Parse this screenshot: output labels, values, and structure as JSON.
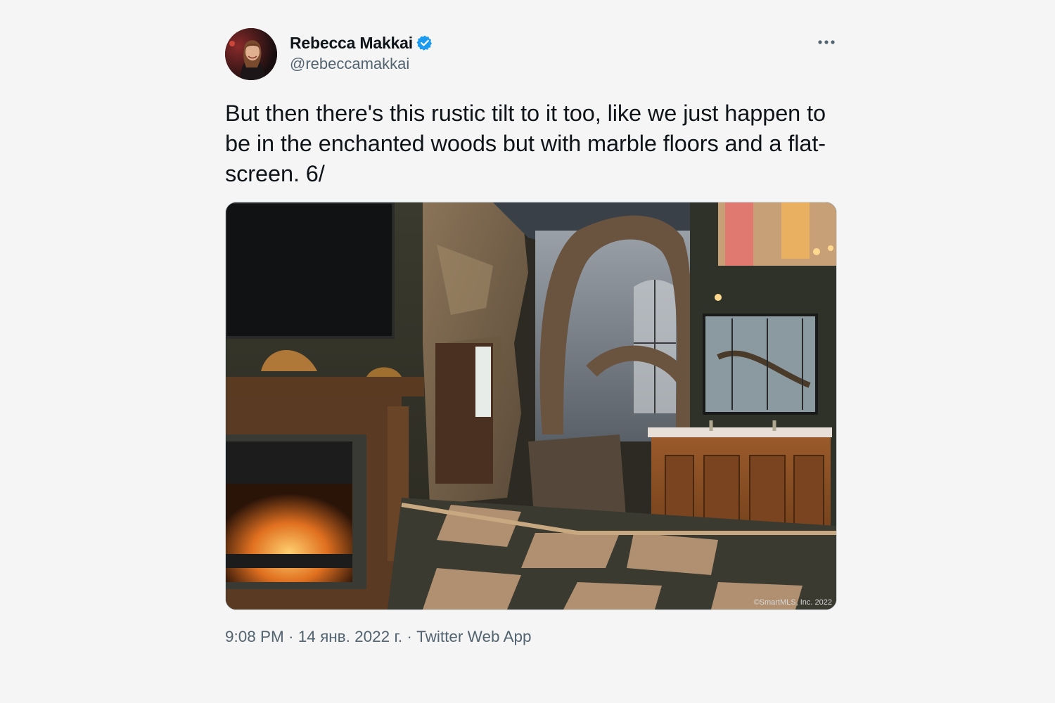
{
  "author": {
    "display_name": "Rebecca Makkai",
    "handle": "@rebeccamakkai",
    "verified": true,
    "avatar_icon": "profile-photo"
  },
  "tweet": {
    "text": "But then there's this rustic tilt to it too, like we just happen to be in the enchanted woods but with marble floors and a flat-screen. 6/",
    "media_watermark": "©SmartMLS, Inc. 2022"
  },
  "meta": {
    "time": "9:08 PM",
    "separator": " · ",
    "date": "14 янв. 2022 г.",
    "source": "Twitter Web App"
  },
  "icons": {
    "verified": "verified-badge-icon",
    "more": "more-options-icon"
  },
  "colors": {
    "background": "#f5f5f5",
    "text": "#0f1419",
    "secondary": "#536471",
    "verified": "#1d9bf0"
  }
}
